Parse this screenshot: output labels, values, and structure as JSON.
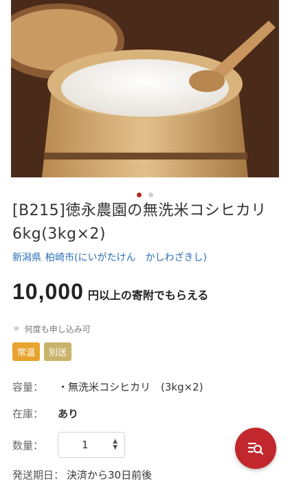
{
  "hero": {
    "image_alt": "rice in wooden ohitsu",
    "slide_index": 1,
    "slide_count": 2
  },
  "product": {
    "title": "[B215]徳永農園の無洗米コシヒカリ6kg(3kg×2)",
    "prefecture": "新潟県",
    "city": "柏崎市(にいがたけん　かしわざきし)"
  },
  "price": {
    "amount": "10,000",
    "suffix": "円以上の寄附でもらえる"
  },
  "repeat_note": "何度も申し込み可",
  "badges": [
    "常温",
    "別送"
  ],
  "specs": {
    "capacity_label": "容量：",
    "capacity_value": "・無洗米コシヒカリ　(3kg×2)",
    "stock_label": "在庫：",
    "stock_value": "あり",
    "quantity_label": "数量：",
    "quantity_value": "1"
  },
  "shipping": {
    "label": "発送期日：",
    "value": "決済から30日前後"
  },
  "colors": {
    "accent": "#c1272d",
    "link": "#2a6db5",
    "badge_normal": "#e8a42e",
    "badge_separate": "#c9b36a"
  },
  "icons": {
    "fab": "search-list-icon",
    "star": "star-icon"
  }
}
